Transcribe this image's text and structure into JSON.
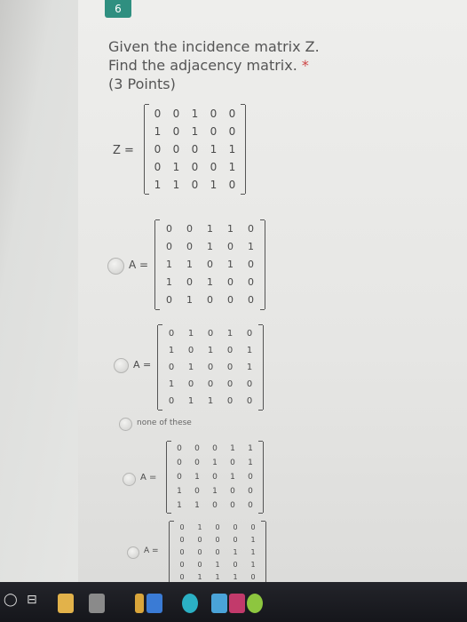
{
  "question": {
    "number": "6",
    "line1": "Given the incidence matrix Z.",
    "line2": "Find the adjacency matrix.",
    "required_mark": "*",
    "points": "(3 Points)"
  },
  "matrix_z": {
    "label": "Z =",
    "rows": [
      [
        "0",
        "0",
        "1",
        "0",
        "0"
      ],
      [
        "1",
        "0",
        "1",
        "0",
        "0"
      ],
      [
        "0",
        "0",
        "0",
        "1",
        "1"
      ],
      [
        "0",
        "1",
        "0",
        "0",
        "1"
      ],
      [
        "1",
        "1",
        "0",
        "1",
        "0"
      ]
    ]
  },
  "options": [
    {
      "label": "A =",
      "rows": [
        [
          "0",
          "0",
          "1",
          "1",
          "0"
        ],
        [
          "0",
          "0",
          "1",
          "0",
          "1"
        ],
        [
          "1",
          "1",
          "0",
          "1",
          "0"
        ],
        [
          "1",
          "0",
          "1",
          "0",
          "0"
        ],
        [
          "0",
          "1",
          "0",
          "0",
          "0"
        ]
      ]
    },
    {
      "label": "A =",
      "rows": [
        [
          "0",
          "1",
          "0",
          "1",
          "0"
        ],
        [
          "1",
          "0",
          "1",
          "0",
          "1"
        ],
        [
          "0",
          "1",
          "0",
          "0",
          "1"
        ],
        [
          "1",
          "0",
          "0",
          "0",
          "0"
        ],
        [
          "0",
          "1",
          "1",
          "0",
          "0"
        ]
      ]
    },
    {
      "label": "none of these"
    },
    {
      "label": "A =",
      "rows": [
        [
          "0",
          "0",
          "0",
          "1",
          "1"
        ],
        [
          "0",
          "0",
          "1",
          "0",
          "1"
        ],
        [
          "0",
          "1",
          "0",
          "1",
          "0"
        ],
        [
          "1",
          "0",
          "1",
          "0",
          "0"
        ],
        [
          "1",
          "1",
          "0",
          "0",
          "0"
        ]
      ]
    },
    {
      "label": "A =",
      "rows": [
        [
          "0",
          "1",
          "0",
          "0",
          "0"
        ],
        [
          "0",
          "0",
          "0",
          "0",
          "1"
        ],
        [
          "0",
          "0",
          "0",
          "1",
          "1"
        ],
        [
          "0",
          "0",
          "1",
          "0",
          "1"
        ],
        [
          "0",
          "1",
          "1",
          "1",
          "0"
        ]
      ]
    }
  ],
  "taskbar": {
    "icons": [
      {
        "name": "notes-icon",
        "color": "#e2b24a"
      },
      {
        "name": "calculator-icon",
        "color": "#8a8a8a"
      },
      {
        "name": "folder-icon",
        "color": "#d9a53a"
      },
      {
        "name": "mail-icon",
        "color": "#3a7bd5"
      },
      {
        "name": "browser-icon",
        "color": "#2bb0c4"
      },
      {
        "name": "store-icon",
        "color": "#4aa3d8"
      },
      {
        "name": "media-icon",
        "color": "#c23a6b"
      },
      {
        "name": "chat-icon",
        "color": "#8dc63f"
      }
    ]
  }
}
